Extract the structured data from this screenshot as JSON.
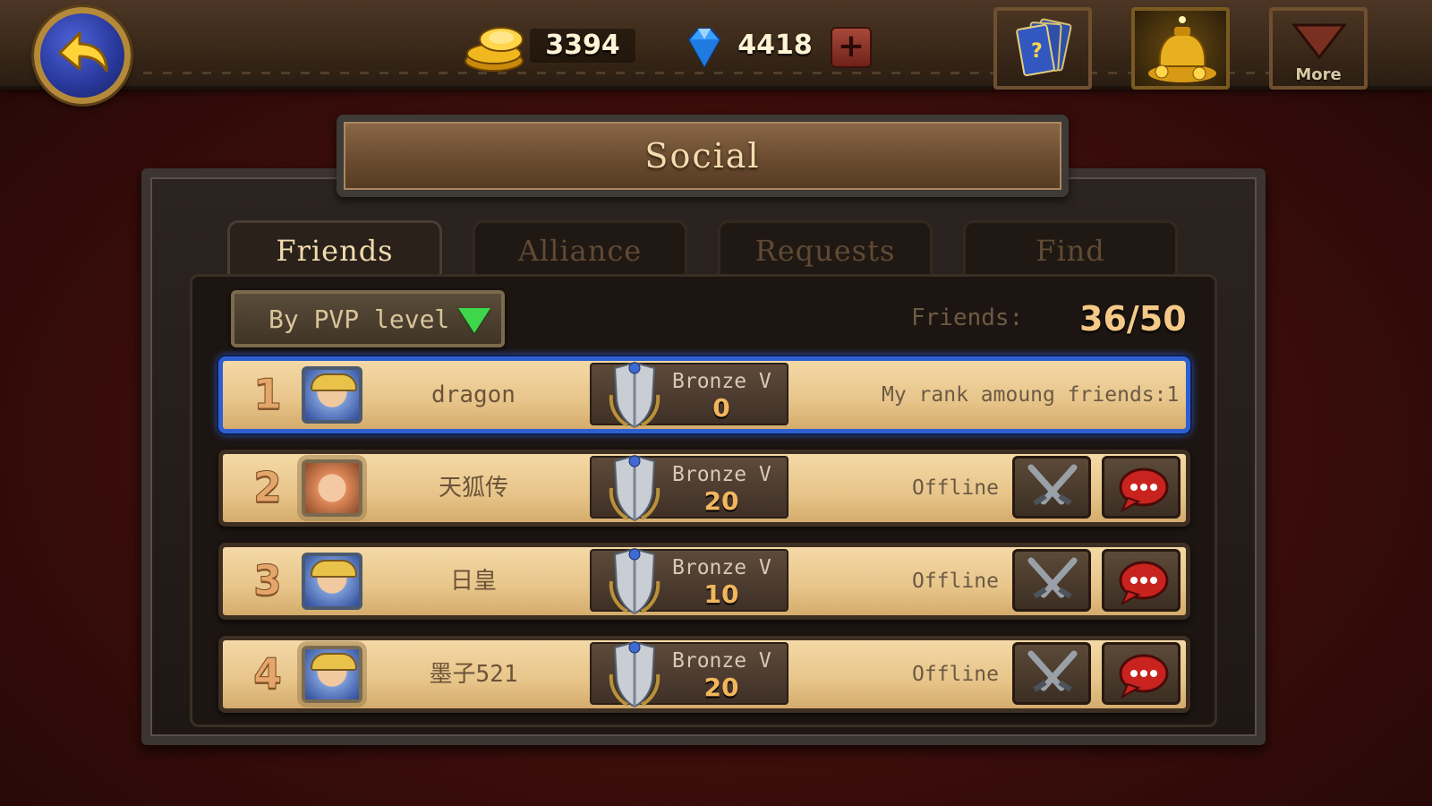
{
  "top": {
    "gold": "3394",
    "gems": "4418",
    "more_label": "More"
  },
  "title": "Social",
  "tabs": [
    {
      "label": "Friends",
      "active": true
    },
    {
      "label": "Alliance",
      "active": false
    },
    {
      "label": "Requests",
      "active": false
    },
    {
      "label": "Find",
      "active": false
    }
  ],
  "sort": {
    "label": "By PVP level"
  },
  "friends_label": "Friends:",
  "friends_count": "36/50",
  "rows": [
    {
      "rank": "1",
      "name": "dragon",
      "tier": "Bronze V",
      "points": "0",
      "status": "My rank amoung friends:1"
    },
    {
      "rank": "2",
      "name": "天狐传",
      "tier": "Bronze V",
      "points": "20",
      "status": "Offline"
    },
    {
      "rank": "3",
      "name": "日皇",
      "tier": "Bronze V",
      "points": "10",
      "status": "Offline"
    },
    {
      "rank": "4",
      "name": "墨子521",
      "tier": "Bronze V",
      "points": "20",
      "status": "Offline"
    }
  ],
  "icons": {
    "back": "back-arrow-icon",
    "gold": "gold-coins-icon",
    "gem": "diamond-icon",
    "plus": "plus-icon",
    "cards": "card-deck-icon",
    "treasure": "treasure-icon",
    "more": "chevron-down-icon",
    "rank_shield": "shield-icon",
    "fight": "crossed-swords-icon",
    "chat": "chat-bubble-icon"
  },
  "colors": {
    "accent_gold": "#f4c988",
    "sort_arrow": "#3ed64a",
    "highlight_border": "#2d5fd0",
    "chat_red": "#c8231e"
  }
}
